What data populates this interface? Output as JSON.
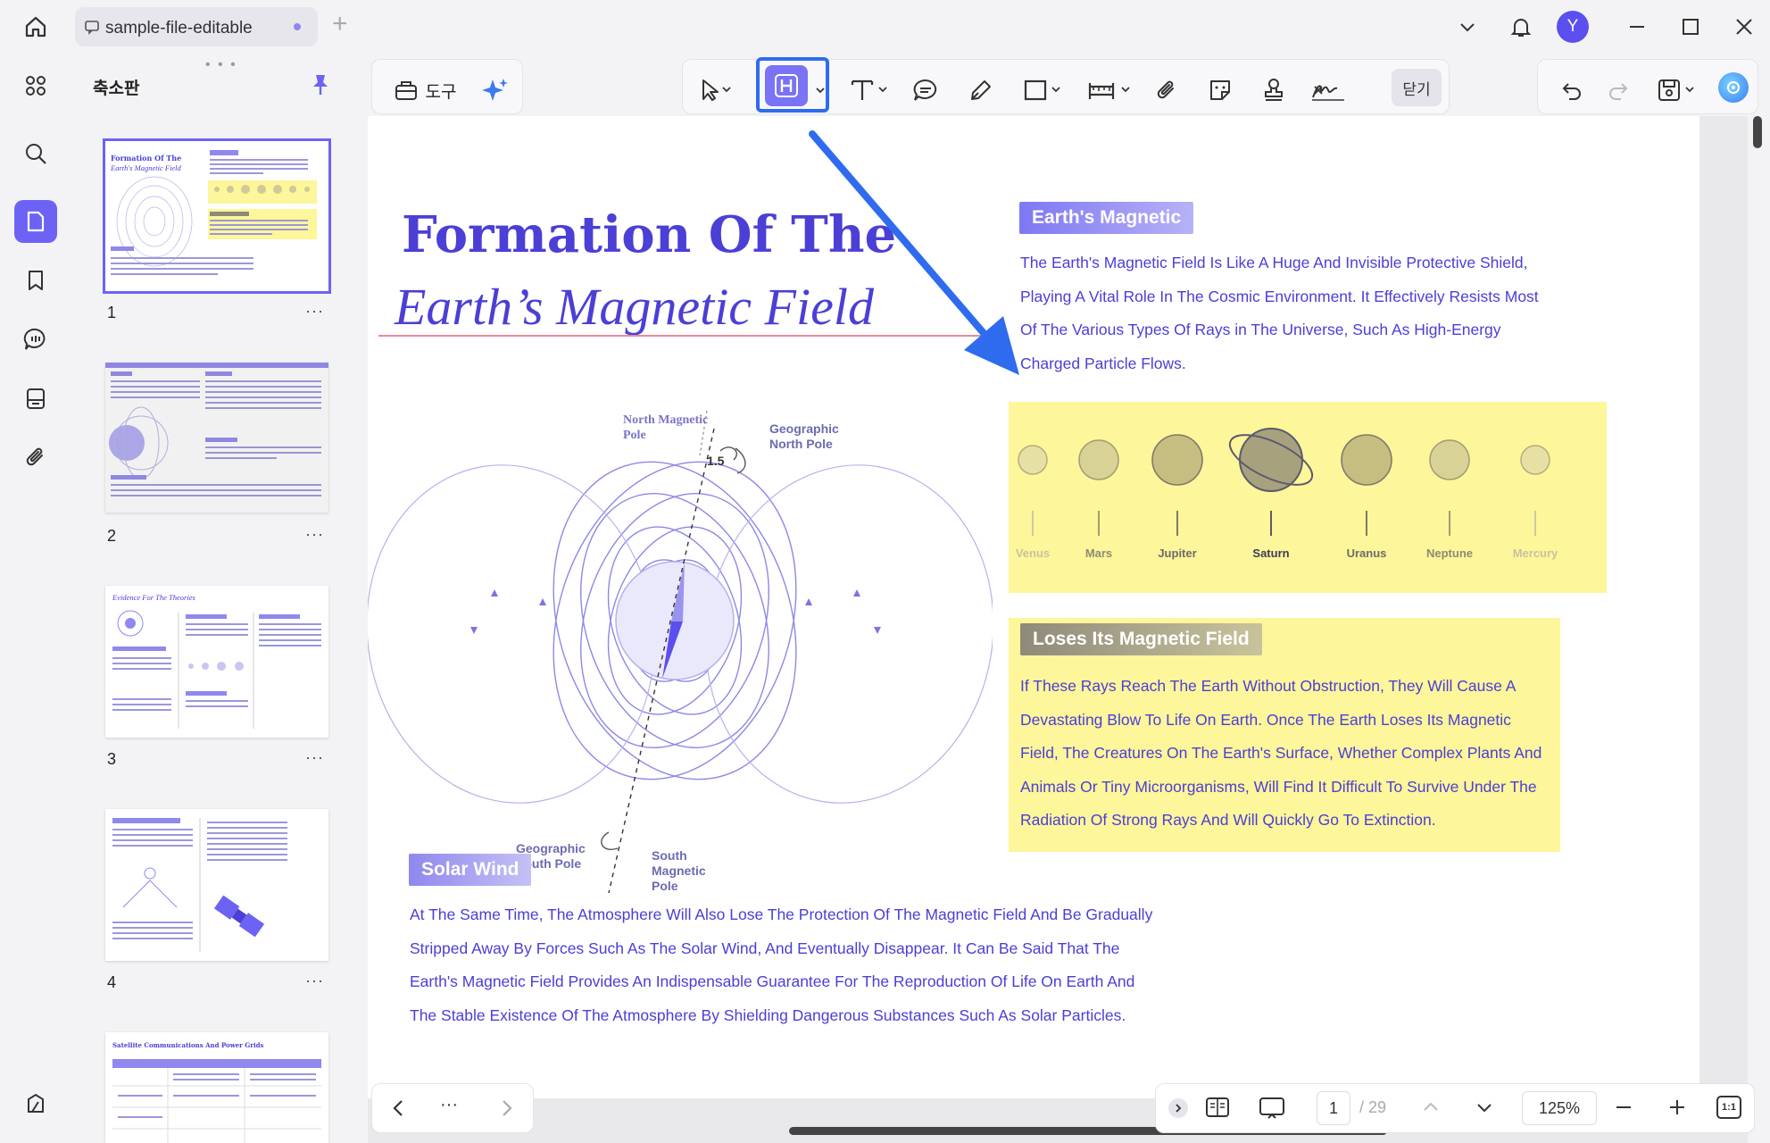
{
  "titlebar": {
    "tab_label": "sample-file-editable",
    "new_tab": "+",
    "avatar_letter": "Y",
    "colors": {
      "avatar": "#5b4ff0",
      "dot": "#8f88ee"
    }
  },
  "sidebar": {
    "panel_title": "축소판",
    "pages": [
      {
        "number": "1",
        "more": "···"
      },
      {
        "number": "2",
        "more": "···"
      },
      {
        "number": "3",
        "more": "···"
      },
      {
        "number": "4",
        "more": "···"
      }
    ],
    "thumb_text": {
      "p1_title": "Formation Of The",
      "p1_subtitle": "Earth's Magnetic Field",
      "p3_title": "Evidence For The Theories",
      "p5_title": "Satellite Communications And Power Grids"
    }
  },
  "toolbar": {
    "tools_label": "도구",
    "close_label": "닫기",
    "icons": [
      "pointer-icon",
      "highlight-icon",
      "text-icon",
      "comment-icon",
      "pen-icon",
      "rectangle-icon",
      "measure-icon",
      "attachment-icon",
      "sticker-icon",
      "stamp-icon",
      "signature-icon"
    ]
  },
  "document": {
    "title_line1": "Formation Of The",
    "title_line2": "Earth’s Magnetic Field",
    "section1_title": "Earth's Magnetic",
    "section1_body": "The Earth's Magnetic Field Is Like A Huge And Invisible Protective Shield, Playing A Vital Role In The Cosmic Environment. It Effectively Resists Most Of The Various Types Of Rays in The Universe, Such As High-Energy Charged Particle Flows.",
    "planets": [
      "Venus",
      "Mars",
      "Jupiter",
      "Saturn",
      "Uranus",
      "Neptune",
      "Mercury"
    ],
    "section2_title": "Loses Its Magnetic Field",
    "section2_body": "If These Rays Reach The Earth Without Obstruction, They Will Cause A Devastating Blow To Life On Earth. Once The Earth Loses Its Magnetic Field, The Creatures On The Earth's Surface, Whether Complex Plants And Animals Or Tiny Microorganisms, Will Find It Difficult To Survive Under The Radiation Of Strong Rays And Will Quickly Go To Extinction.",
    "section3_title": "Solar Wind",
    "section3_body": "At The Same Time, The Atmosphere Will Also Lose The Protection Of The Magnetic Field And Be Gradually Stripped Away By Forces Such As The Solar Wind, And Eventually Disappear. It Can Be Said That The Earth's Magnetic Field Provides An Indispensable Guarantee For The Reproduction Of Life On Earth And The Stable Existence Of The Atmosphere By Shielding Dangerous Substances Such As Solar Particles.",
    "diagram": {
      "north_magnetic_pole": "North Magnetic Pole",
      "geographic_north_pole": "Geographic North Pole",
      "angle": "1.5",
      "geographic_south_pole": "Geographic South Pole",
      "south_magnetic_pole": "South Magnetic Pole"
    }
  },
  "navigation": {
    "current_page": "1",
    "total_pages": "/ 29",
    "zoom": "125%",
    "more": "···",
    "actual_size": "1:1"
  },
  "colors": {
    "accent": "#6c63f5",
    "doc_text": "#4b3fd6",
    "highlight_yellow": "#fdf69a",
    "arrow_blue": "#2f6bef"
  }
}
